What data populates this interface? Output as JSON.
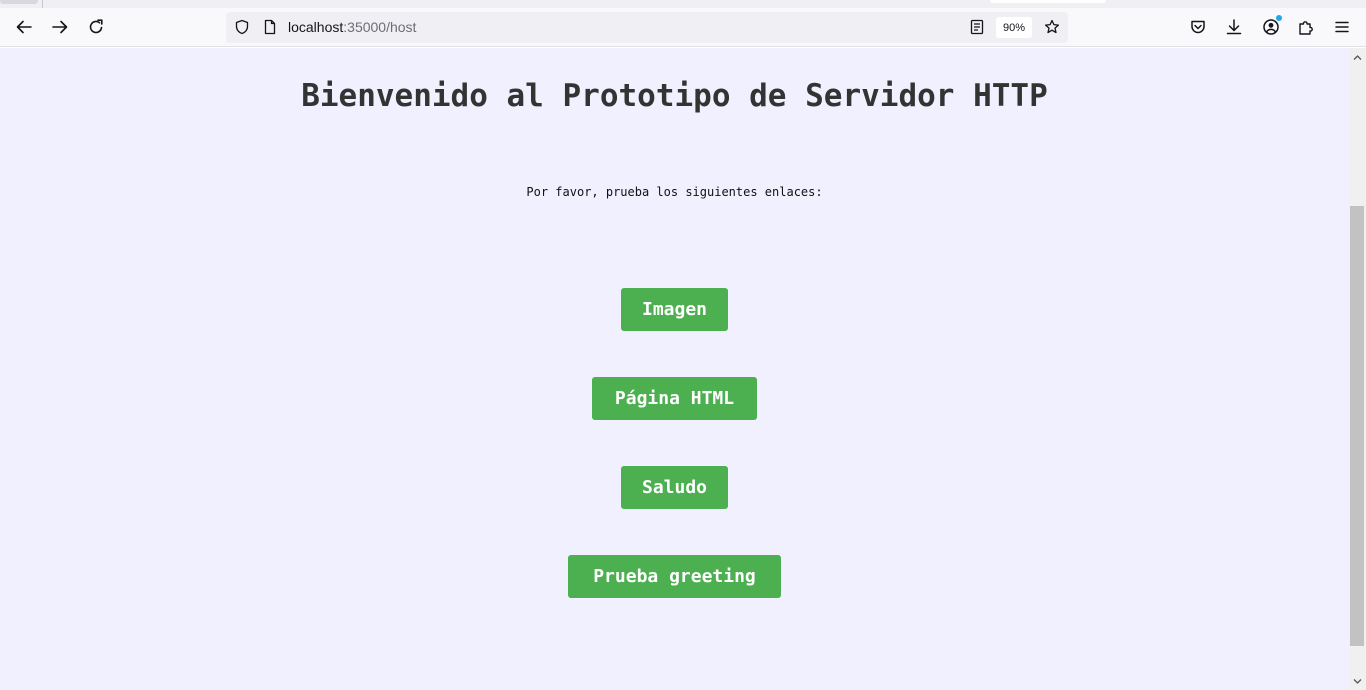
{
  "browser": {
    "url_host": "localhost",
    "url_rest": ":35000/host",
    "zoom": "90%",
    "toolbar": {
      "back": "arrow-left-icon",
      "forward": "arrow-right-icon",
      "reload": "reload-icon",
      "shield": "shield-icon",
      "page": "page-icon",
      "reader": "reader-view-icon",
      "bookmark": "star-icon",
      "pocket": "pocket-icon",
      "downloads": "download-icon",
      "account": "account-icon",
      "extensions": "puzzle-icon",
      "menu": "hamburger-menu-icon"
    }
  },
  "page": {
    "title": "Bienvenido al Prototipo de Servidor HTTP",
    "intro": "Por favor, prueba los siguientes enlaces:",
    "links": [
      {
        "label": "Imagen"
      },
      {
        "label": "Página HTML"
      },
      {
        "label": "Saludo"
      },
      {
        "label": "Prueba greeting"
      }
    ],
    "background": "#f0f0ff",
    "button_color": "#4caf50"
  }
}
